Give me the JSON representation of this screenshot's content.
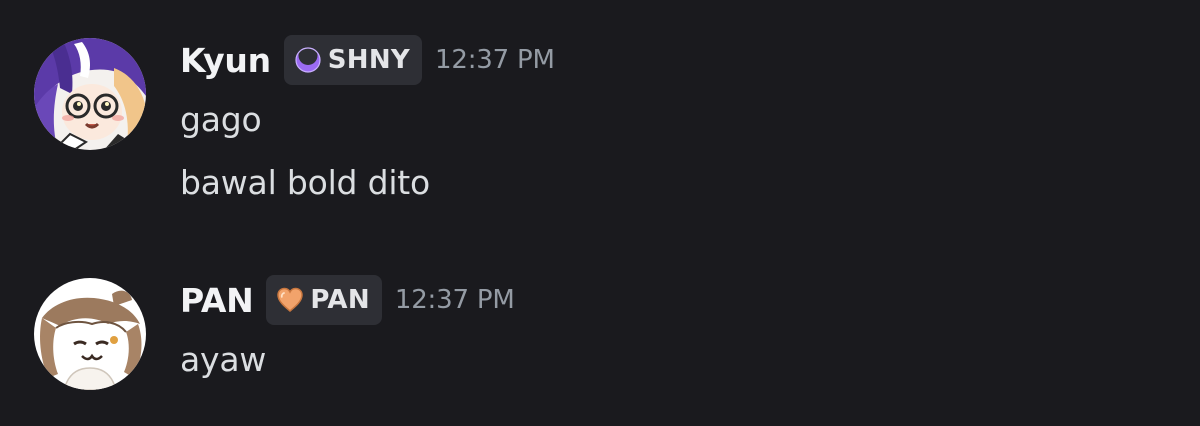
{
  "messages": [
    {
      "username": "Kyun",
      "tag": {
        "label": "SHNY",
        "icon": "purple-crescent-icon",
        "color": "#8b5cf6"
      },
      "timestamp": "12:37 PM",
      "lines": [
        "gago",
        "bawal bold dito"
      ]
    },
    {
      "username": "PAN",
      "tag": {
        "label": "PAN",
        "icon": "orange-heart-icon",
        "color": "#f2a36b"
      },
      "timestamp": "12:37 PM",
      "lines": [
        "ayaw"
      ]
    }
  ],
  "colors": {
    "background": "#1a1a1e",
    "username": "#f2f3f5",
    "message_text": "#dbdee1",
    "timestamp": "#949ba4",
    "tag_background": "#2e2f35"
  }
}
